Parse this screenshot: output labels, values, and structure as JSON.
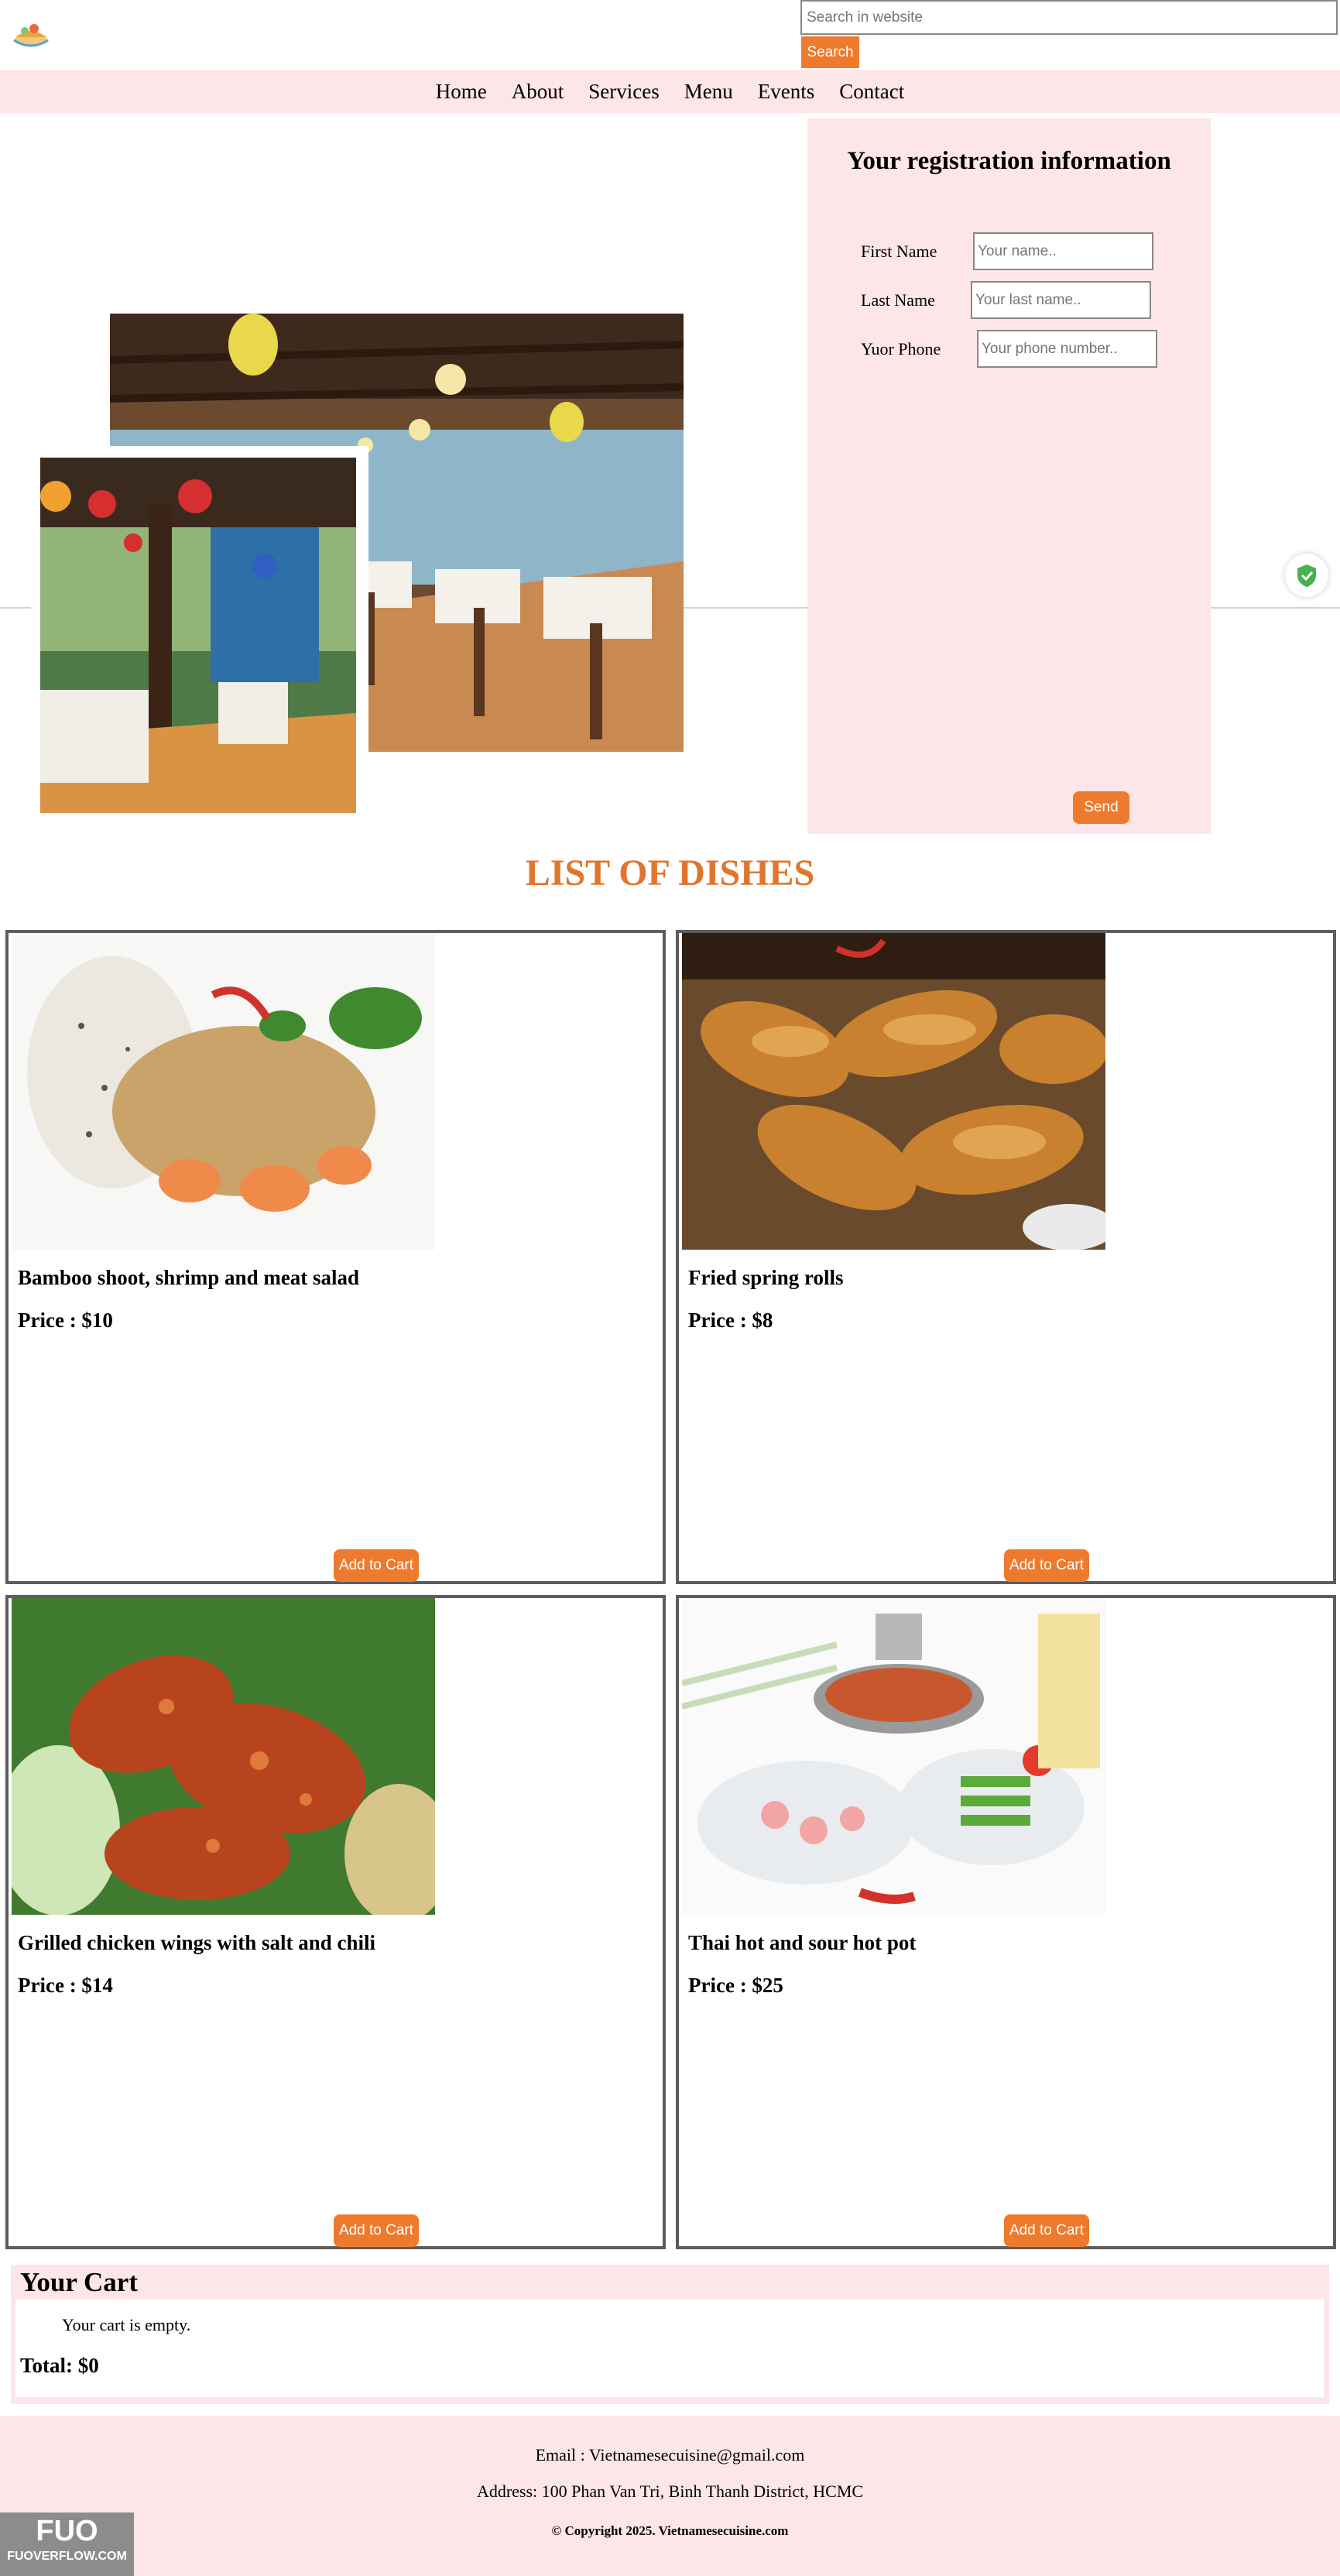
{
  "header": {
    "search_placeholder": "Search in website",
    "search_button": "Search"
  },
  "nav": [
    "Home",
    "About",
    "Services",
    "Menu",
    "Events",
    "Contact"
  ],
  "registration": {
    "title": "Your registration information",
    "first_name_label": "First Name",
    "first_name_placeholder": "Your name..",
    "last_name_label": "Last Name",
    "last_name_placeholder": "Your last name..",
    "phone_label": "Yuor Phone",
    "phone_placeholder": "Your phone number..",
    "send_button": "Send"
  },
  "dishes": {
    "title": "LIST OF DISHES",
    "add_to_cart_label": "Add to Cart",
    "items": [
      {
        "name": "Bamboo shoot, shrimp and meat salad",
        "price": "Price : $10"
      },
      {
        "name": "Fried spring rolls",
        "price": "Price : $8"
      },
      {
        "name": "Grilled chicken wings with salt and chili",
        "price": "Price : $14"
      },
      {
        "name": "Thai hot and sour hot pot",
        "price": "Price : $25"
      }
    ]
  },
  "cart": {
    "title": "Your Cart",
    "empty_text": "Your cart is empty.",
    "total": "Total: $0"
  },
  "footer": {
    "email": "Email : Vietnamesecuisine@gmail.com",
    "address": "Address: 100 Phan Van Tri, Binh Thanh District, HCMC",
    "copyright": "© Copyright 2025. Vietnamesecuisine.com"
  },
  "watermark": {
    "logo_text": "FUO",
    "site": "FUOVERFLOW.COM"
  },
  "colors": {
    "accent": "#ee7a2d",
    "panel": "#fde6e7",
    "title_orange": "#e0752d"
  },
  "icons": [
    "food-logo-icon",
    "shield-check-icon"
  ]
}
